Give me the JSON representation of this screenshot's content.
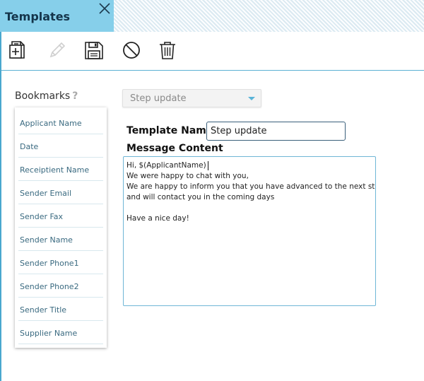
{
  "window": {
    "tab_title": "Templates",
    "close_icon": "close-icon"
  },
  "toolbar": {
    "buttons": [
      {
        "name": "new-template-button",
        "icon": "new-document-icon",
        "enabled": true
      },
      {
        "name": "edit-button",
        "icon": "pencil-icon",
        "enabled": false
      },
      {
        "name": "save-button",
        "icon": "floppy-disk-icon",
        "enabled": true
      },
      {
        "name": "cancel-button",
        "icon": "prohibited-icon",
        "enabled": true
      },
      {
        "name": "delete-button",
        "icon": "trash-icon",
        "enabled": true
      }
    ]
  },
  "bookmarks": {
    "title": "Bookmarks",
    "help": "?",
    "items": [
      "Applicant Name",
      "Date",
      "Receiptient Name",
      "Sender Email",
      "Sender Fax",
      "Sender Name",
      "Sender Phone1",
      "Sender Phone2",
      "Sender Title",
      "Supplier Name"
    ]
  },
  "form": {
    "template_select_value": "Step update",
    "template_name_label": "Template Name",
    "template_name_value": "Step update",
    "message_label": "Message Content",
    "message_lines": [
      "Hi, $(ApplicantName)",
      "We were happy to chat with you,",
      "We are happy to inform you that you have advanced to the next stage",
      "and will contact you in the coming days",
      "",
      "Have a nice day!"
    ]
  },
  "colors": {
    "tab_bg": "#86cfea",
    "accent": "#4aa8cf",
    "bookmark_text": "#3a6a80"
  }
}
